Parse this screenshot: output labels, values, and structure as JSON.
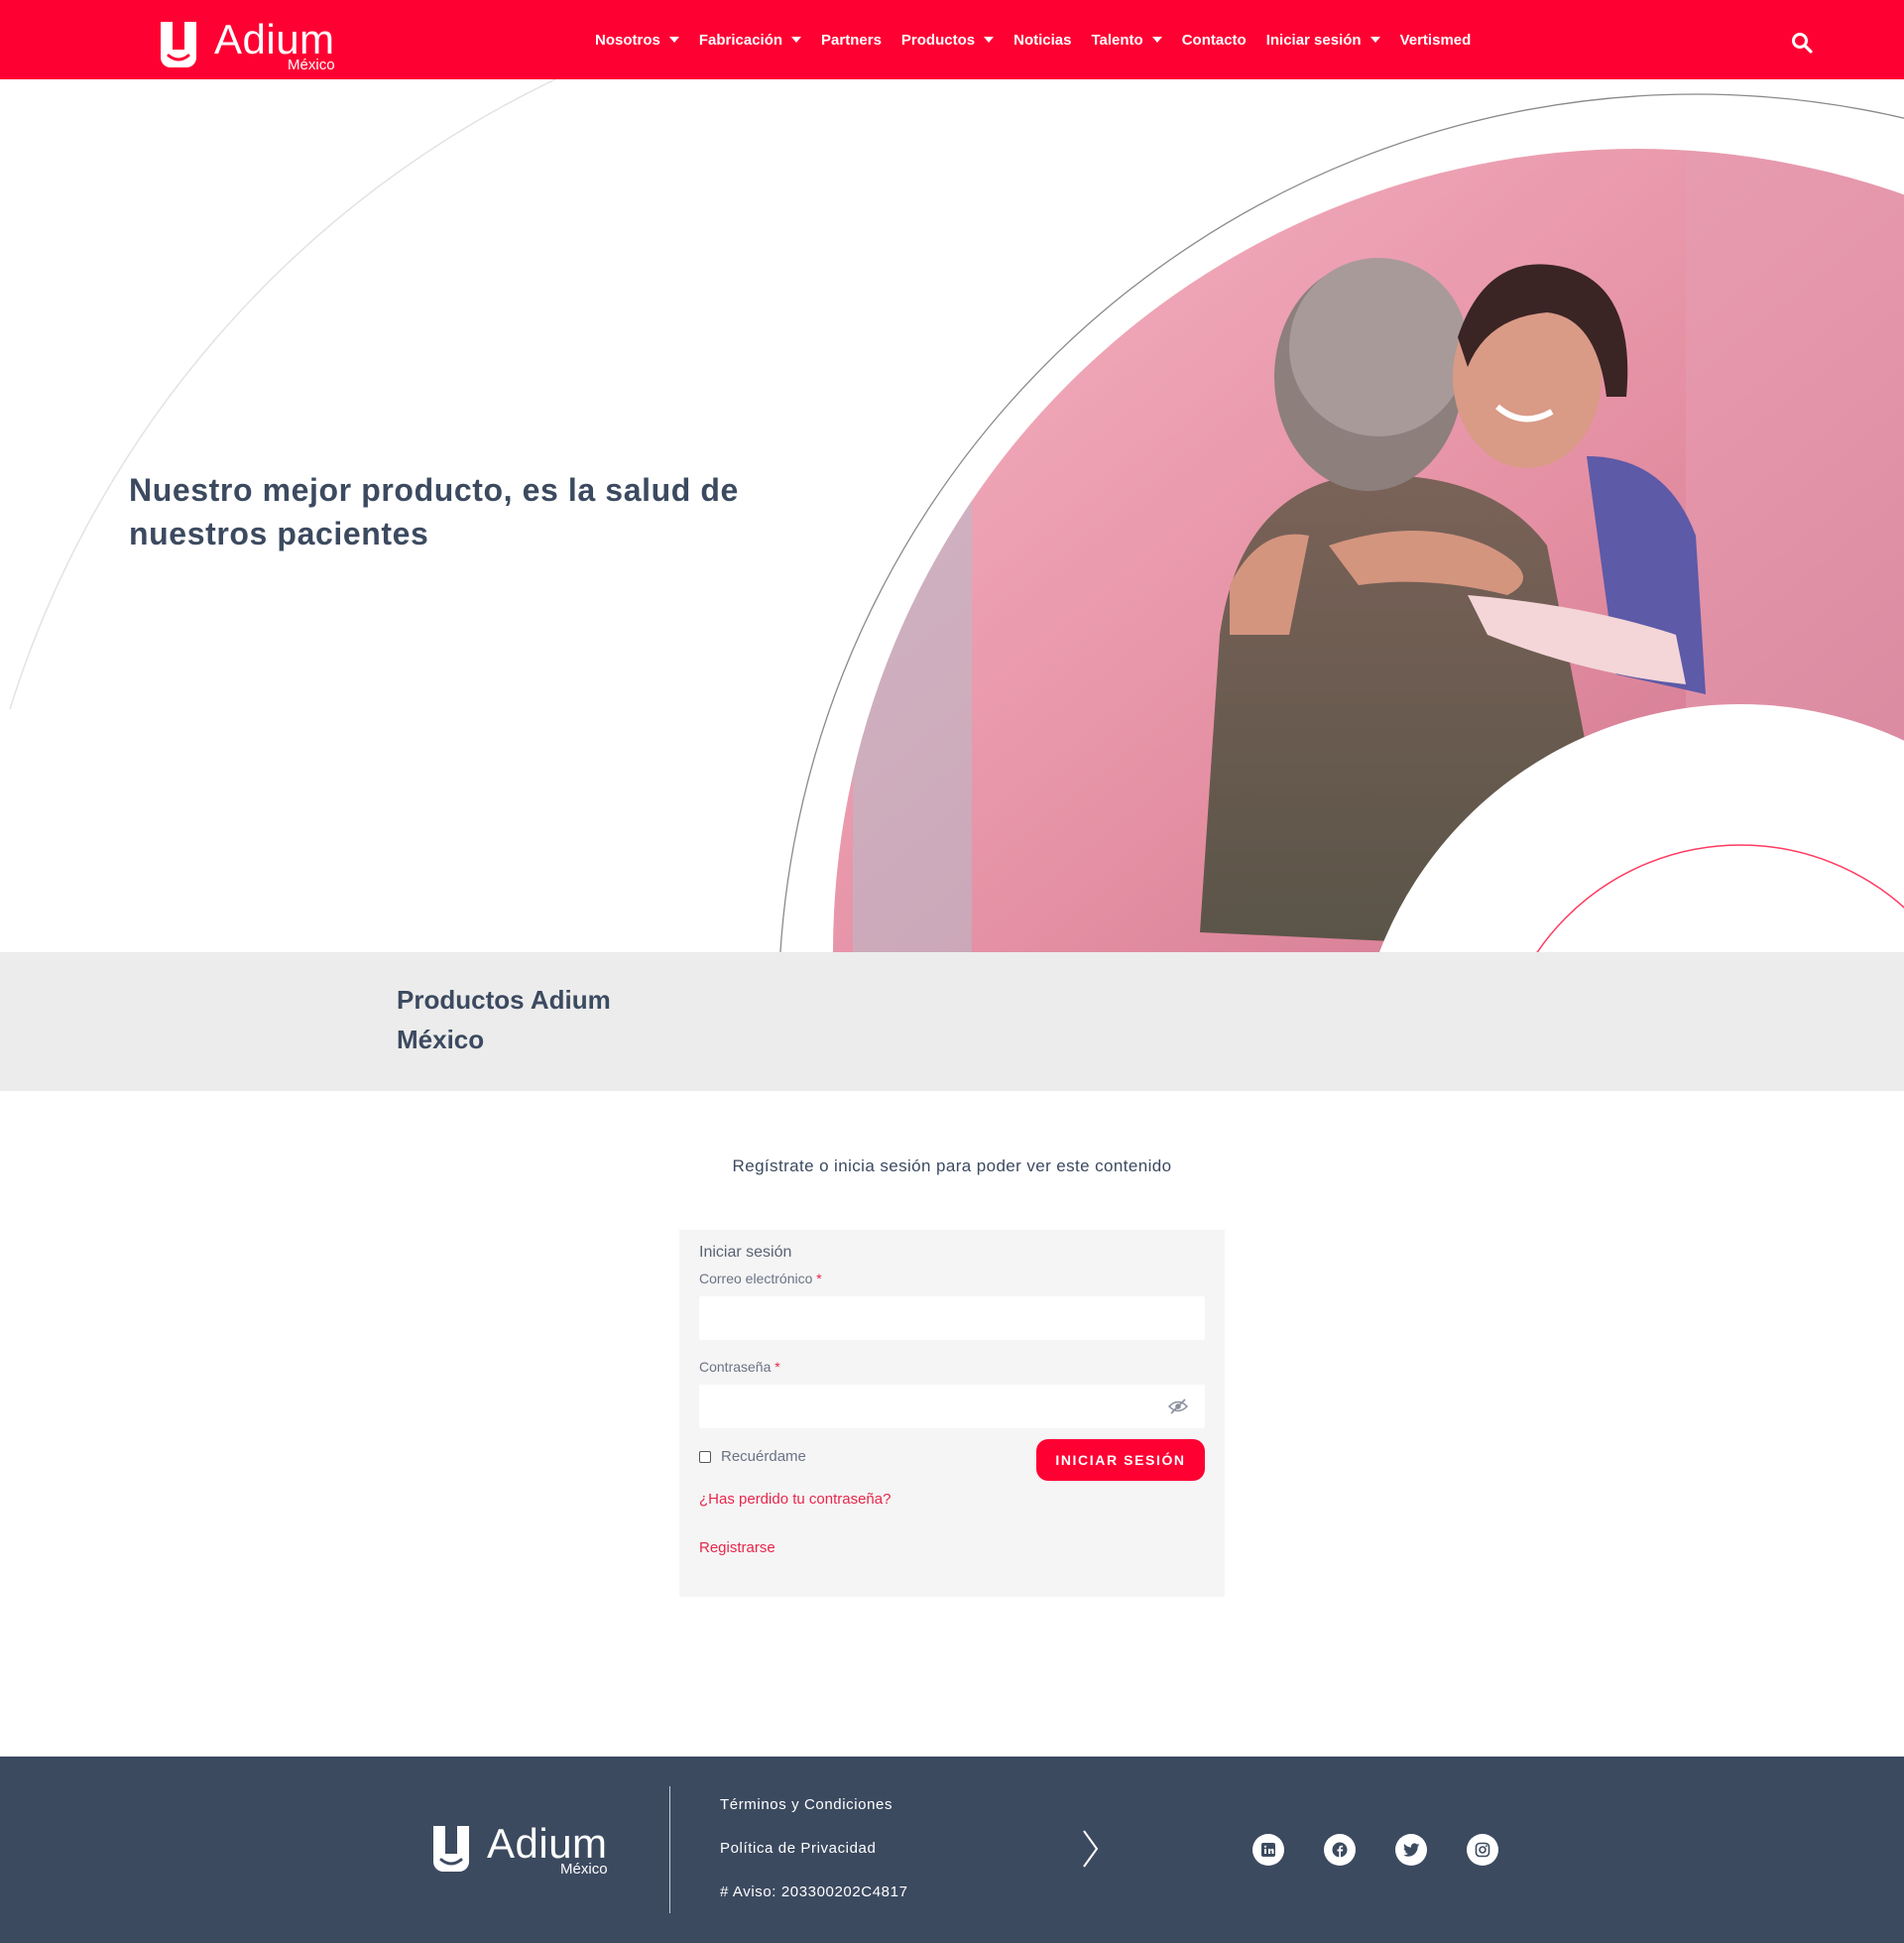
{
  "header": {
    "logo": {
      "word": "Adium",
      "sub": "México"
    },
    "nav": [
      {
        "label": "Nosotros",
        "dropdown": true
      },
      {
        "label": "Fabricación",
        "dropdown": true
      },
      {
        "label": "Partners",
        "dropdown": false
      },
      {
        "label": "Productos",
        "dropdown": true
      },
      {
        "label": "Noticias",
        "dropdown": false
      },
      {
        "label": "Talento",
        "dropdown": true
      },
      {
        "label": "Contacto",
        "dropdown": false
      },
      {
        "label": "Iniciar sesión",
        "dropdown": true
      },
      {
        "label": "Vertismed",
        "dropdown": false
      }
    ],
    "search_icon": "search-icon"
  },
  "hero": {
    "title": "Nuestro mejor producto, es la salud de nuestros pacientes",
    "image": "nurse-hugging-elderly-patient-photo"
  },
  "products": {
    "title": "Productos Adium México"
  },
  "login": {
    "notice": "Regístrate o inicia sesión para poder ver este contenido",
    "heading": "Iniciar sesión",
    "email_label": "Correo electrónico",
    "password_label": "Contraseña",
    "required_mark": "*",
    "remember_label": "Recuérdame",
    "submit_label": "INICIAR SESIÓN",
    "lost_password": "¿Has perdido tu contraseña?",
    "register": "Registrarse"
  },
  "footer": {
    "logo": {
      "word": "Adium",
      "sub": "México"
    },
    "links": [
      "Términos y Condiciones",
      "Política de Privacidad",
      "# Aviso: 203300202C4817"
    ],
    "social": [
      "linkedin-icon",
      "facebook-icon",
      "twitter-icon",
      "instagram-icon"
    ]
  },
  "colors": {
    "brand_red": "#ff0033",
    "text_dark": "#3c4a60",
    "footer_bg": "#3c4a60",
    "band_gray": "#ececec"
  }
}
